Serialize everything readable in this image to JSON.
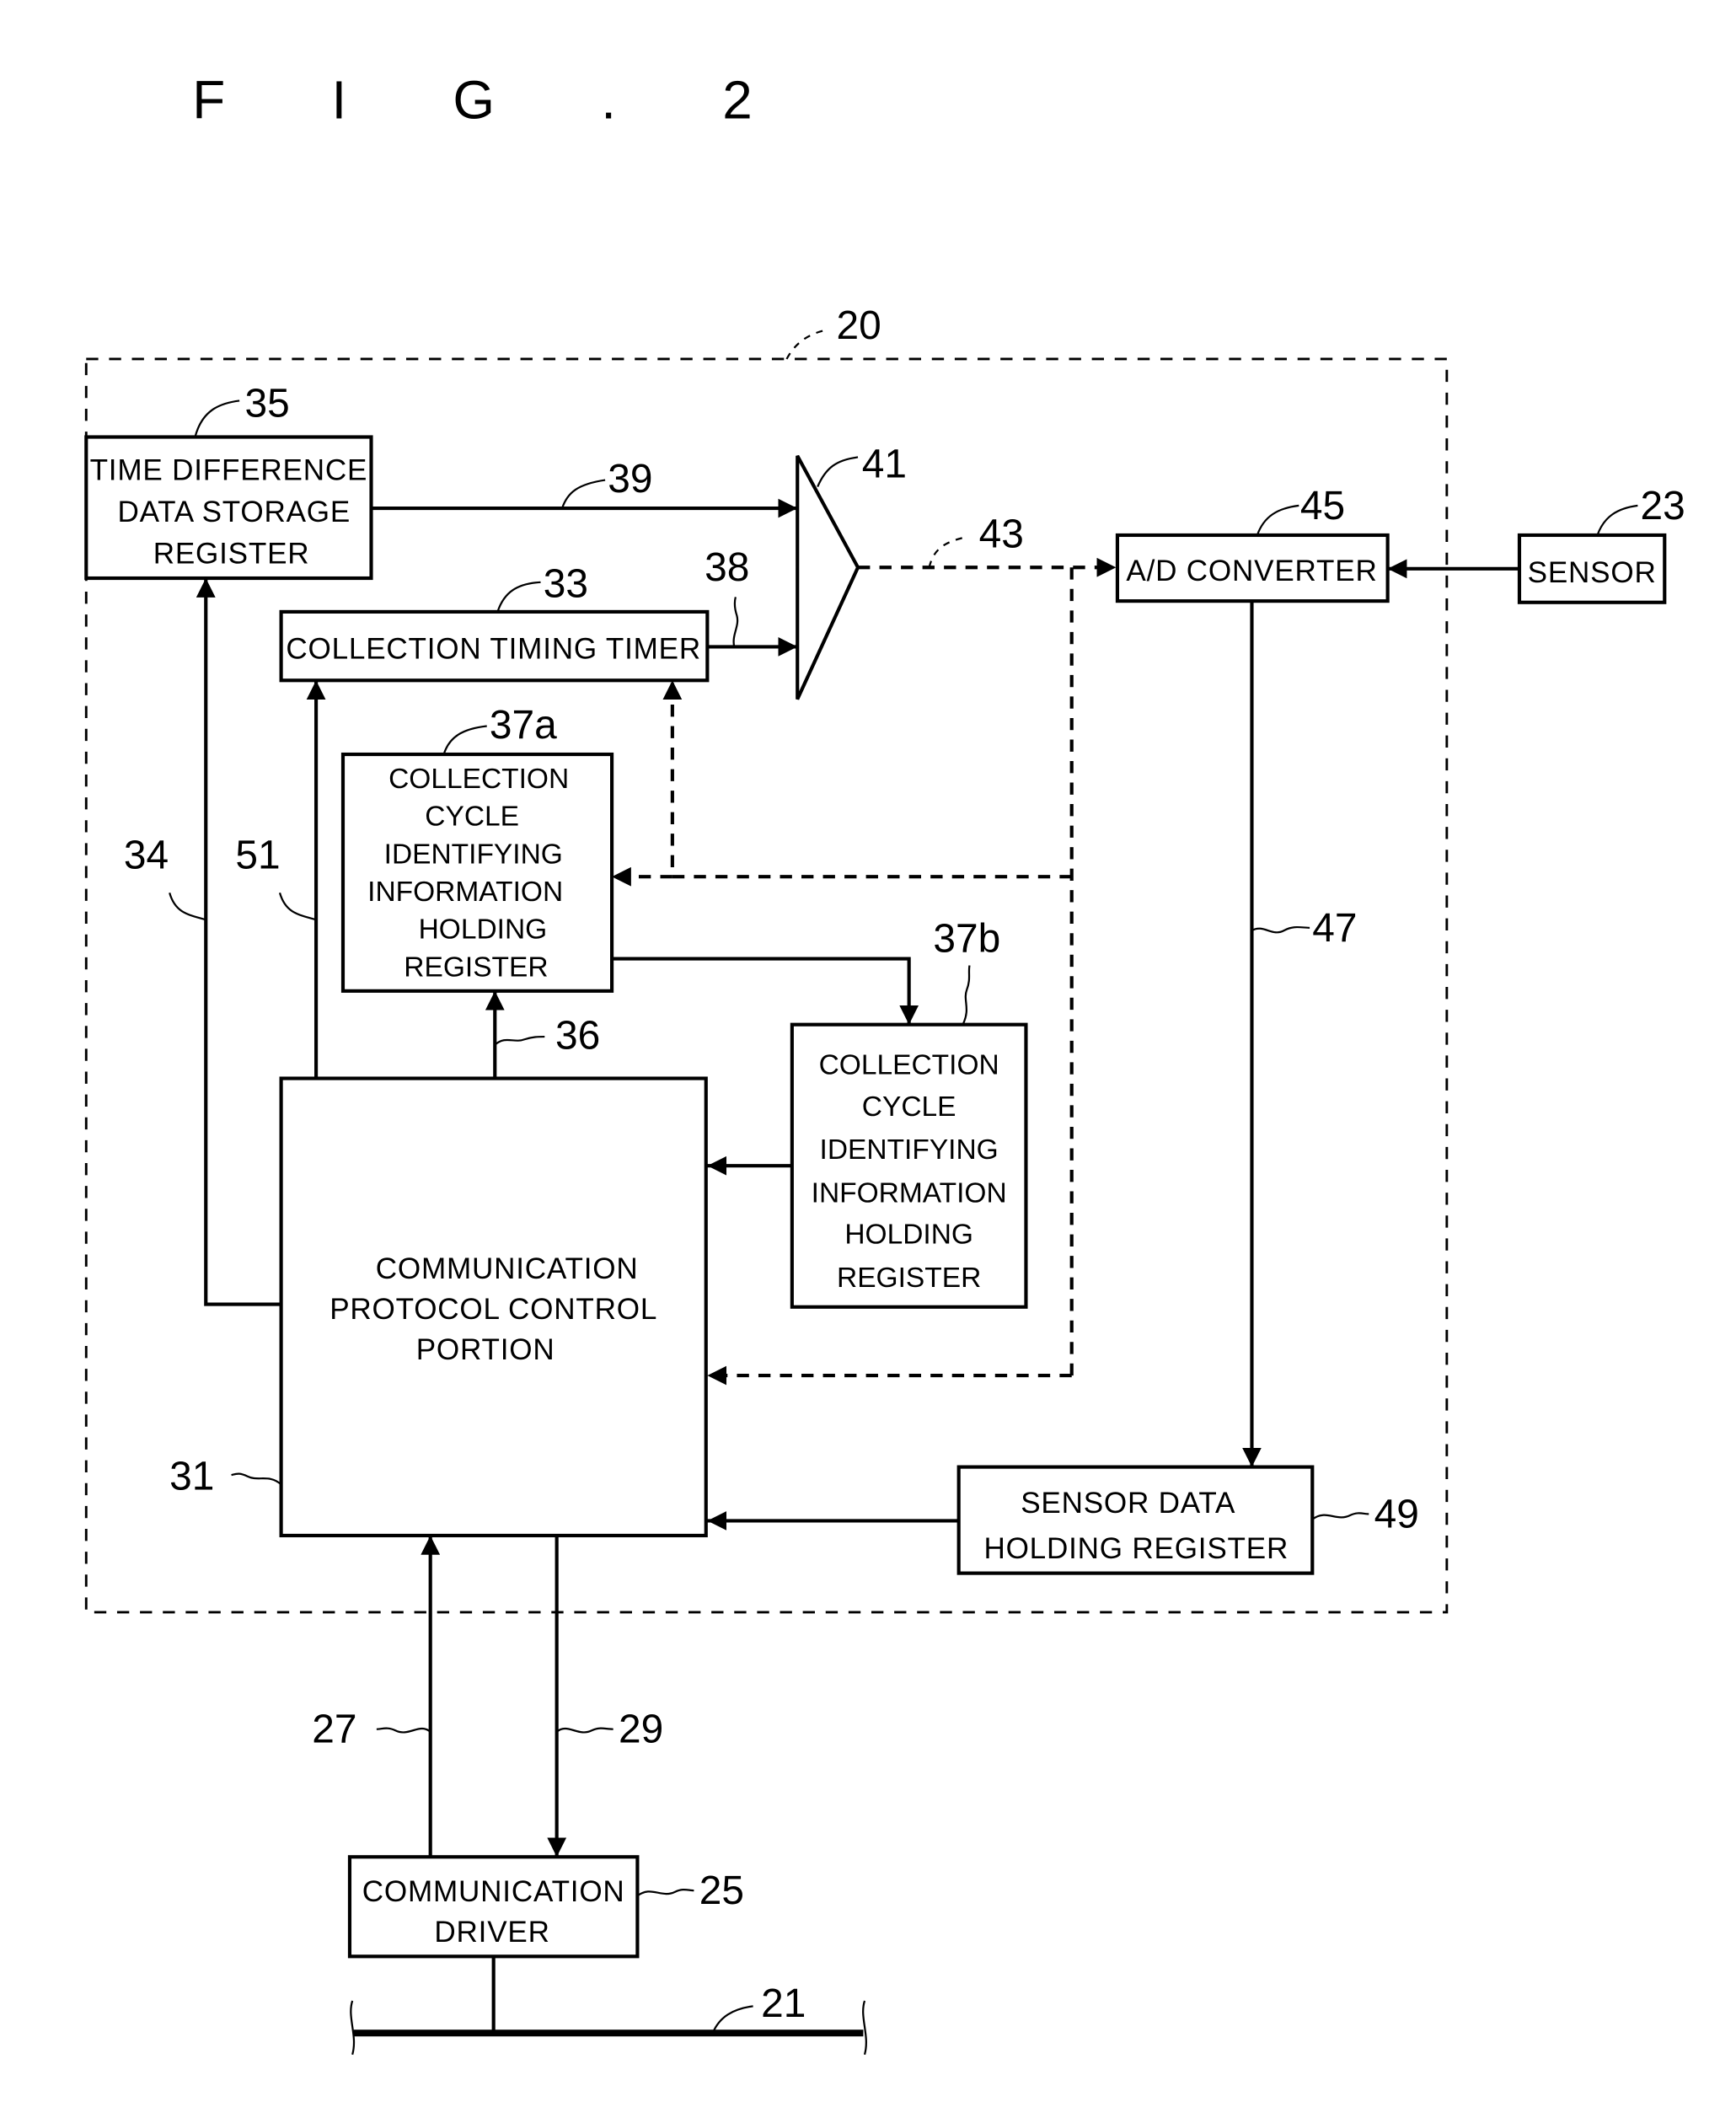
{
  "figure": {
    "title": "F I G . 2"
  },
  "blocks": {
    "time_difference_register": {
      "ref": "35",
      "lines": [
        "TIME DIFFERENCE",
        "DATA STORAGE",
        "REGISTER"
      ]
    },
    "collection_timing_timer": {
      "ref": "33",
      "lines": [
        "COLLECTION TIMING TIMER"
      ]
    },
    "cycle_register_a": {
      "ref": "37a",
      "lines": [
        "COLLECTION",
        "CYCLE",
        "IDENTIFYING",
        "INFORMATION",
        "HOLDING",
        "REGISTER"
      ]
    },
    "cycle_register_b": {
      "ref": "37b",
      "lines": [
        "COLLECTION",
        "CYCLE",
        "IDENTIFYING",
        "INFORMATION",
        "HOLDING",
        "REGISTER"
      ]
    },
    "comm_protocol_control": {
      "ref": "31",
      "lines": [
        "COMMUNICATION",
        "PROTOCOL CONTROL",
        "PORTION"
      ]
    },
    "ad_converter": {
      "ref": "45",
      "lines": [
        "A/D CONVERTER"
      ]
    },
    "sensor": {
      "ref": "23",
      "lines": [
        "SENSOR"
      ]
    },
    "sensor_data_register": {
      "ref": "49",
      "lines": [
        "SENSOR DATA",
        "HOLDING REGISTER"
      ]
    },
    "communication_driver": {
      "ref": "25",
      "lines": [
        "COMMUNICATION",
        "DRIVER"
      ]
    },
    "multiplexer": {
      "ref": "41"
    }
  },
  "references": {
    "unit": "20",
    "bus": "21",
    "line_27": "27",
    "line_29": "29",
    "line_34": "34",
    "line_36": "36",
    "line_38": "38",
    "line_39": "39",
    "line_43": "43",
    "line_47": "47",
    "line_51": "51"
  }
}
